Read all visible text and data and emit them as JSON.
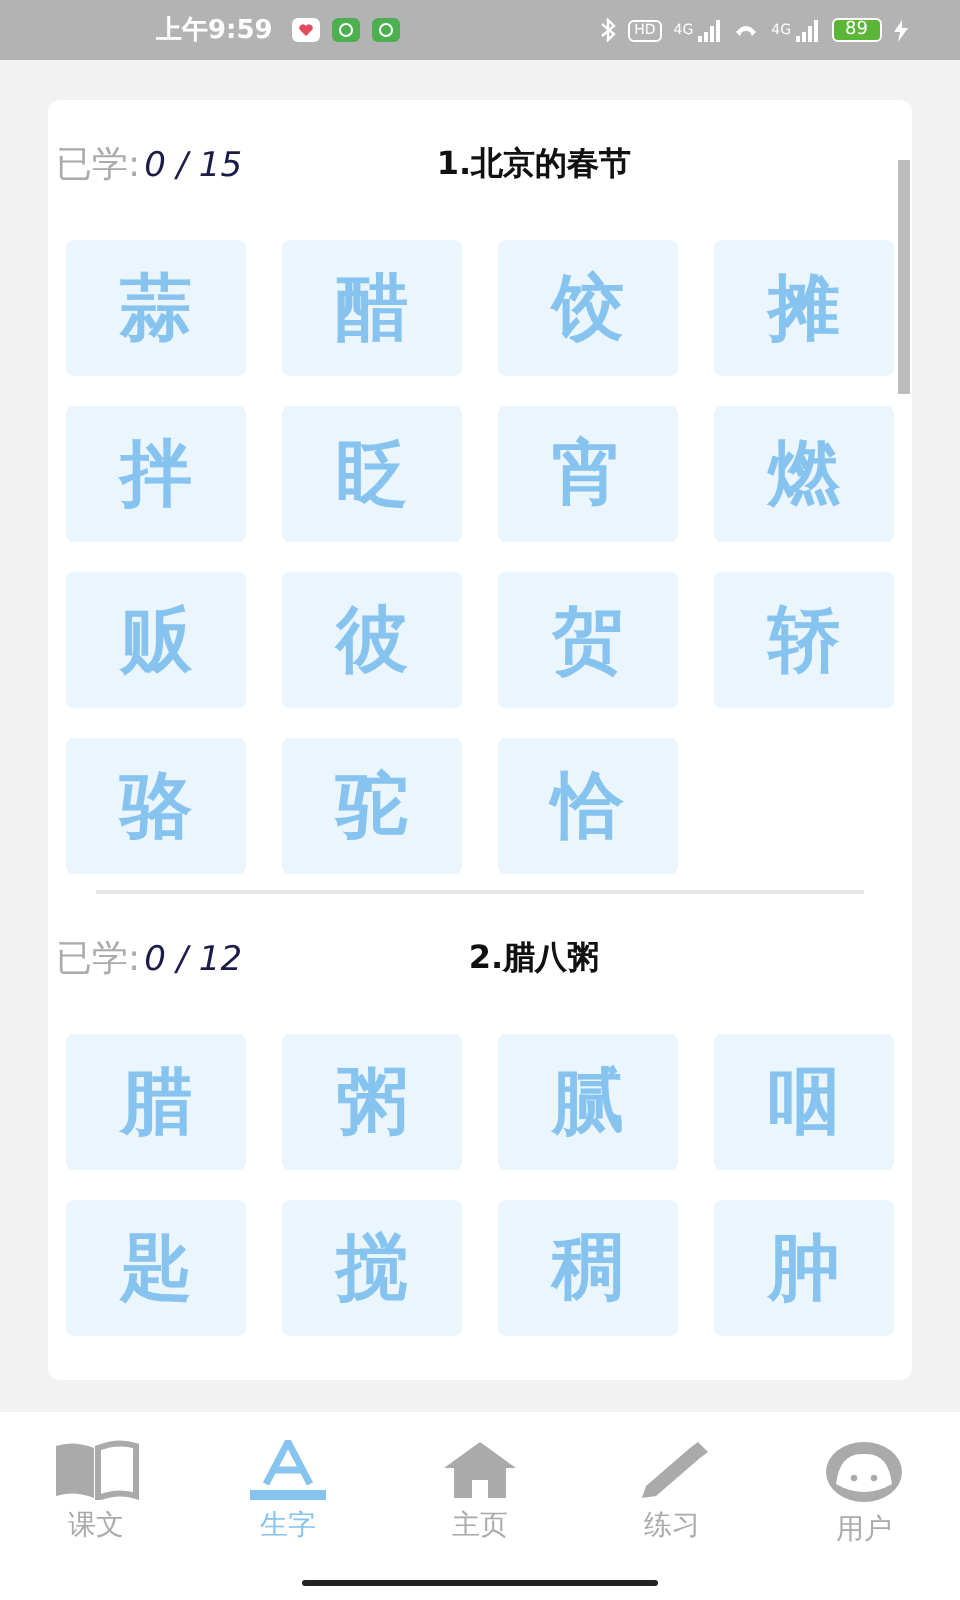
{
  "status_bar": {
    "time": "上午9:59",
    "notifications": [
      {
        "kind": "heart"
      },
      {
        "kind": "chat"
      },
      {
        "kind": "chat"
      }
    ],
    "indicators": [
      {
        "kind": "bluetooth"
      },
      {
        "kind": "hd",
        "label": "HD"
      },
      {
        "kind": "signal",
        "label": "4G"
      },
      {
        "kind": "call"
      },
      {
        "kind": "signal",
        "label": "4G"
      }
    ],
    "battery": {
      "label": "89",
      "charging": true
    }
  },
  "lessons": [
    {
      "learned_label": "已学:",
      "count": "0 / 15",
      "title": "1.北京的春节",
      "characters": [
        "蒜",
        "醋",
        "饺",
        "摊",
        "拌",
        "眨",
        "宵",
        "燃",
        "贩",
        "彼",
        "贺",
        "轿",
        "骆",
        "驼",
        "恰"
      ]
    },
    {
      "learned_label": "已学:",
      "count": "0 / 12",
      "title": "2.腊八粥",
      "characters": [
        "腊",
        "粥",
        "腻",
        "咽",
        "匙",
        "搅",
        "稠",
        "肿"
      ]
    }
  ],
  "bottom_nav": [
    {
      "kind": "book",
      "label": "课文",
      "selected": false
    },
    {
      "kind": "letter",
      "label": "生字",
      "selected": true
    },
    {
      "kind": "home",
      "label": "主页",
      "selected": false
    },
    {
      "kind": "pencil",
      "label": "练习",
      "selected": false
    },
    {
      "kind": "face",
      "label": "用户",
      "selected": false
    }
  ]
}
